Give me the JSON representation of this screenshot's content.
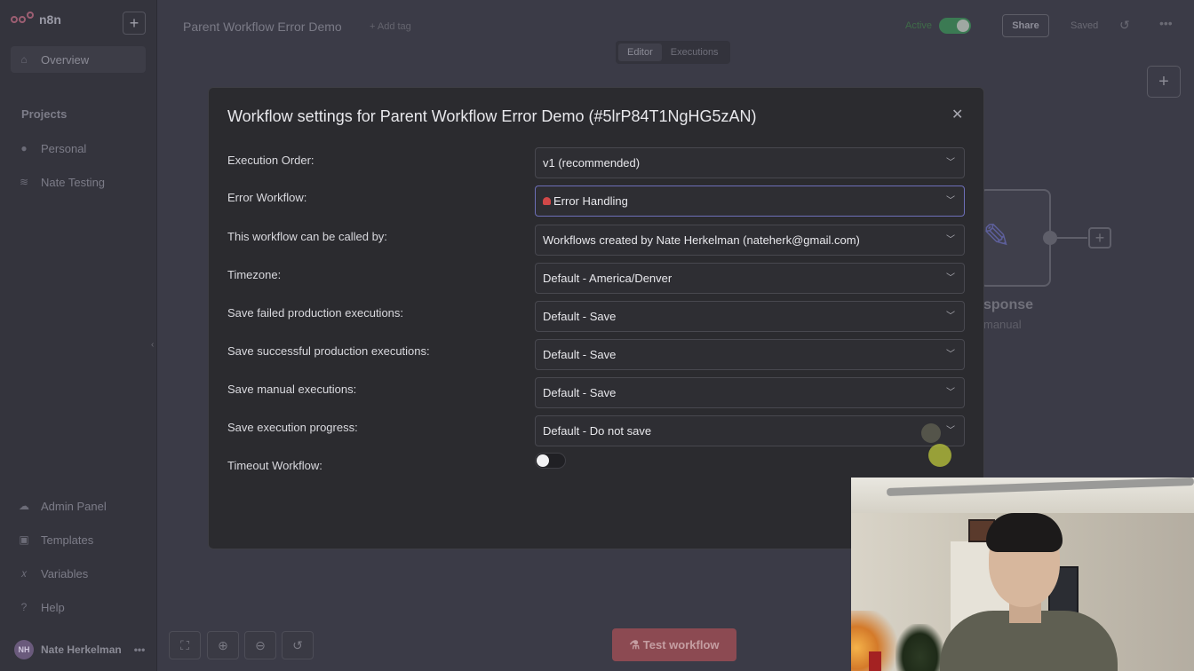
{
  "sidebar": {
    "brand": "n8n",
    "new_button": "+",
    "overview": "Overview",
    "projects_heading": "Projects",
    "projects": [
      "Personal",
      "Nate Testing"
    ],
    "bottom_items": [
      "Admin Panel",
      "Templates",
      "Variables",
      "Help"
    ],
    "user_initials": "NH",
    "user_name": "Nate Herkelman"
  },
  "header": {
    "workflow_name": "Parent Workflow Error Demo",
    "add_tag": "+ Add tag",
    "active_label": "Active",
    "share": "Share",
    "saved": "Saved",
    "tabs": [
      "Editor",
      "Executions"
    ]
  },
  "canvas": {
    "node_title": "sponse",
    "node_subtitle": "manual",
    "test_button": "Test workflow"
  },
  "modal": {
    "title": "Workflow settings for Parent Workflow Error Demo (#5lrP84T1NgHG5zAN)",
    "rows": [
      {
        "label": "Execution Order:",
        "value": "v1 (recommended)"
      },
      {
        "label": "Error Workflow:",
        "value": "Error Handling"
      },
      {
        "label": "This workflow can be called by:",
        "value": "Workflows created by Nate Herkelman (nateherk@gmail.com)"
      },
      {
        "label": "Timezone:",
        "value": "Default - America/Denver"
      },
      {
        "label": "Save failed production executions:",
        "value": "Default - Save"
      },
      {
        "label": "Save successful production executions:",
        "value": "Default - Save"
      },
      {
        "label": "Save manual executions:",
        "value": "Default - Save"
      },
      {
        "label": "Save execution progress:",
        "value": "Default - Do not save"
      }
    ],
    "timeout_label": "Timeout Workflow:",
    "timeout_enabled": false
  },
  "colors": {
    "accent": "#6d6fb8",
    "active_toggle": "#3b7a53",
    "test_button": "#8c4a52"
  }
}
